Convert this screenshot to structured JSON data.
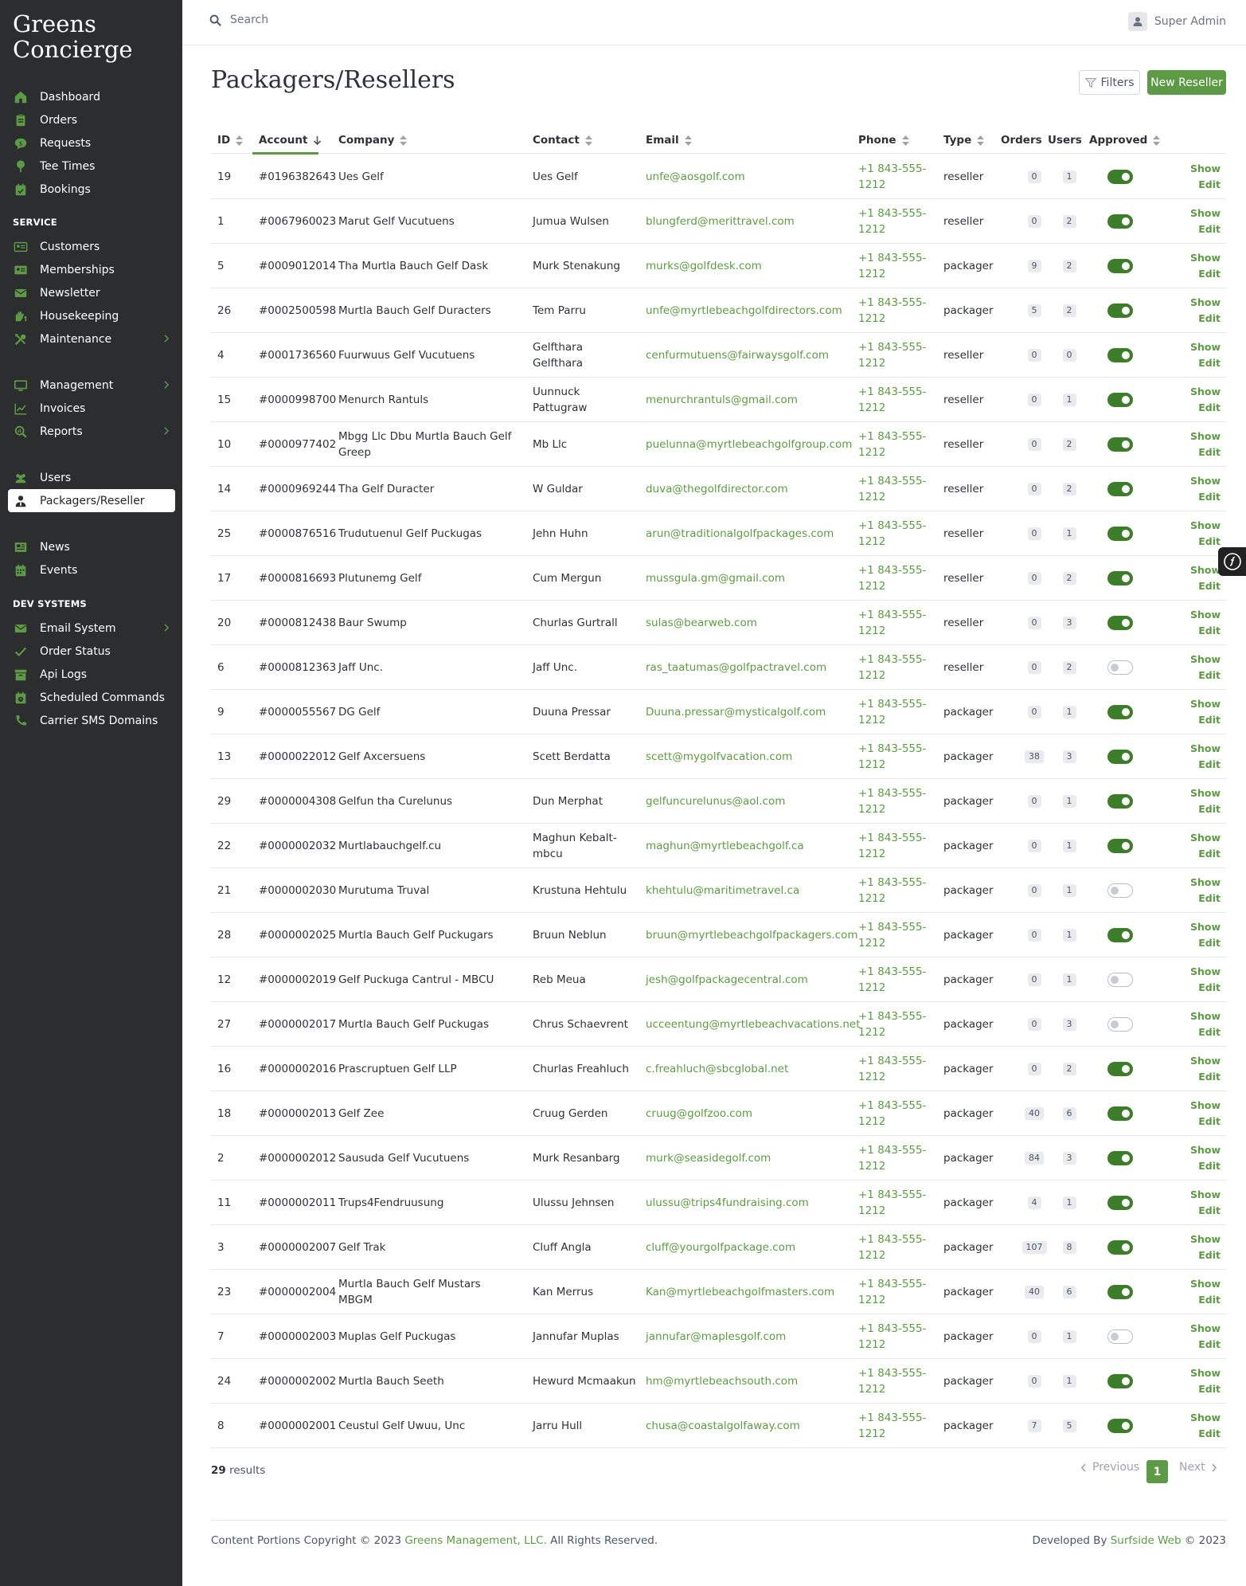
{
  "brand": {
    "line1": "Greens",
    "line2": "Concierge"
  },
  "sidebar": {
    "items_main": [
      {
        "label": "Dashboard",
        "icon": "home-icon"
      },
      {
        "label": "Orders",
        "icon": "clipboard-icon"
      },
      {
        "label": "Requests",
        "icon": "chat-icon"
      },
      {
        "label": "Tee Times",
        "icon": "golf-tee-icon"
      },
      {
        "label": "Bookings",
        "icon": "calendar-check-icon"
      }
    ],
    "section_service": "SERVICE",
    "items_service": [
      {
        "label": "Customers",
        "icon": "address-card-icon"
      },
      {
        "label": "Memberships",
        "icon": "id-card-icon"
      },
      {
        "label": "Newsletter",
        "icon": "envelope-icon"
      },
      {
        "label": "Housekeeping",
        "icon": "hands-icon"
      },
      {
        "label": "Maintenance",
        "icon": "tools-icon"
      }
    ],
    "items_manage": [
      {
        "label": "Management",
        "icon": "monitor-icon"
      },
      {
        "label": "Invoices",
        "icon": "chart-line-icon"
      },
      {
        "label": "Reports",
        "icon": "search-chart-icon"
      }
    ],
    "items_people": [
      {
        "label": "Users",
        "icon": "users-icon"
      },
      {
        "label": "Packagers/Reseller",
        "icon": "user-tie-icon"
      }
    ],
    "items_content": [
      {
        "label": "News",
        "icon": "newspaper-icon"
      },
      {
        "label": "Events",
        "icon": "calendar-icon"
      }
    ],
    "section_dev": "DEV SYSTEMS",
    "items_dev": [
      {
        "label": "Email System",
        "icon": "envelope-icon"
      },
      {
        "label": "Order Status",
        "icon": "check-icon"
      },
      {
        "label": "Api Logs",
        "icon": "archive-icon"
      },
      {
        "label": "Scheduled Commands",
        "icon": "calendar-clock-icon"
      },
      {
        "label": "Carrier SMS Domains",
        "icon": "phone-icon"
      }
    ]
  },
  "topbar": {
    "search_placeholder": "Search",
    "user_name": "Super Admin"
  },
  "page": {
    "title": "Packagers/Resellers",
    "filters_label": "Filters",
    "new_label": "New Reseller"
  },
  "table": {
    "headers": {
      "id": "ID",
      "account": "Account",
      "company": "Company",
      "contact": "Contact",
      "email": "Email",
      "phone": "Phone",
      "type": "Type",
      "orders": "Orders",
      "users": "Users",
      "approved": "Approved"
    },
    "show_label": "Show",
    "edit_label": "Edit",
    "rows": [
      {
        "id": "19",
        "account": "#0196382643",
        "company": "Ues Gelf",
        "contact": "Ues Gelf",
        "email": "unfe@aosgolf.com",
        "phone": "+1 843-555-1212",
        "type": "reseller",
        "orders": "0",
        "users": "1",
        "approved": true
      },
      {
        "id": "1",
        "account": "#0067960023",
        "company": "Marut Gelf Vucutuens",
        "contact": "Jumua Wulsen",
        "email": "blungferd@merittravel.com",
        "phone": "+1 843-555-1212",
        "type": "reseller",
        "orders": "0",
        "users": "2",
        "approved": true
      },
      {
        "id": "5",
        "account": "#0009012014",
        "company": "Tha Murtla Bauch Gelf Dask",
        "contact": "Murk Stenakung",
        "email": "murks@golfdesk.com",
        "phone": "+1 843-555-1212",
        "type": "packager",
        "orders": "9",
        "users": "2",
        "approved": true
      },
      {
        "id": "26",
        "account": "#0002500598",
        "company": "Murtla Bauch Gelf Duracters",
        "contact": "Tem Parru",
        "email": "unfe@myrtlebeachgolfdirectors.com",
        "phone": "+1 843-555-1212",
        "type": "packager",
        "orders": "5",
        "users": "2",
        "approved": true
      },
      {
        "id": "4",
        "account": "#0001736560",
        "company": "Fuurwuus Gelf Vucutuens",
        "contact": "Gelfthara Gelfthara",
        "email": "cenfurmutuens@fairwaysgolf.com",
        "phone": "+1 843-555-1212",
        "type": "reseller",
        "orders": "0",
        "users": "0",
        "approved": true
      },
      {
        "id": "15",
        "account": "#0000998700",
        "company": "Menurch Rantuls",
        "contact": "Uunnuck Pattugraw",
        "email": "menurchrantuls@gmail.com",
        "phone": "+1 843-555-1212",
        "type": "reseller",
        "orders": "0",
        "users": "1",
        "approved": true
      },
      {
        "id": "10",
        "account": "#0000977402",
        "company": "Mbgg Llc Dbu Murtla Bauch Gelf Greep",
        "contact": "Mb Llc",
        "email": "puelunna@myrtlebeachgolfgroup.com",
        "phone": "+1 843-555-1212",
        "type": "reseller",
        "orders": "0",
        "users": "2",
        "approved": true
      },
      {
        "id": "14",
        "account": "#0000969244",
        "company": "Tha Gelf Duracter",
        "contact": "W Guldar",
        "email": "duva@thegolfdirector.com",
        "phone": "+1 843-555-1212",
        "type": "reseller",
        "orders": "0",
        "users": "2",
        "approved": true
      },
      {
        "id": "25",
        "account": "#0000876516",
        "company": "Trudutuenul Gelf Puckugas",
        "contact": "Jehn Huhn",
        "email": "arun@traditionalgolfpackages.com",
        "phone": "+1 843-555-1212",
        "type": "reseller",
        "orders": "0",
        "users": "1",
        "approved": true
      },
      {
        "id": "17",
        "account": "#0000816693",
        "company": "Plutunemg Gelf",
        "contact": "Cum Mergun",
        "email": "mussgula.gm@gmail.com",
        "phone": "+1 843-555-1212",
        "type": "reseller",
        "orders": "0",
        "users": "2",
        "approved": true
      },
      {
        "id": "20",
        "account": "#0000812438",
        "company": "Baur Swump",
        "contact": "Churlas Gurtrall",
        "email": "sulas@bearweb.com",
        "phone": "+1 843-555-1212",
        "type": "reseller",
        "orders": "0",
        "users": "3",
        "approved": true
      },
      {
        "id": "6",
        "account": "#0000812363",
        "company": "Jaff Unc.",
        "contact": "Jaff Unc.",
        "email": "ras_taatumas@golfpactravel.com",
        "phone": "+1 843-555-1212",
        "type": "reseller",
        "orders": "0",
        "users": "2",
        "approved": false
      },
      {
        "id": "9",
        "account": "#0000055567",
        "company": "DG Gelf",
        "contact": "Duuna Pressar",
        "email": "Duuna.pressar@mysticalgolf.com",
        "phone": "+1 843-555-1212",
        "type": "packager",
        "orders": "0",
        "users": "1",
        "approved": true
      },
      {
        "id": "13",
        "account": "#0000022012",
        "company": "Gelf Axcersuens",
        "contact": "Scett Berdatta",
        "email": "scett@mygolfvacation.com",
        "phone": "+1 843-555-1212",
        "type": "packager",
        "orders": "38",
        "users": "3",
        "approved": true
      },
      {
        "id": "29",
        "account": "#0000004308",
        "company": "Gelfun tha Curelunus",
        "contact": "Dun Merphat",
        "email": "gelfuncurelunus@aol.com",
        "phone": "+1 843-555-1212",
        "type": "packager",
        "orders": "0",
        "users": "1",
        "approved": true
      },
      {
        "id": "22",
        "account": "#0000002032",
        "company": "Murtlabauchgelf.cu",
        "contact": "Maghun Kebalt-mbcu",
        "email": "maghun@myrtlebeachgolf.ca",
        "phone": "+1 843-555-1212",
        "type": "packager",
        "orders": "0",
        "users": "1",
        "approved": true
      },
      {
        "id": "21",
        "account": "#0000002030",
        "company": "Murutuma Truval",
        "contact": "Krustuna Hehtulu",
        "email": "khehtulu@maritimetravel.ca",
        "phone": "+1 843-555-1212",
        "type": "packager",
        "orders": "0",
        "users": "1",
        "approved": false
      },
      {
        "id": "28",
        "account": "#0000002025",
        "company": "Murtla Bauch Gelf Puckugars",
        "contact": "Bruun Neblun",
        "email": "bruun@myrtlebeachgolfpackagers.com",
        "phone": "+1 843-555-1212",
        "type": "packager",
        "orders": "0",
        "users": "1",
        "approved": true
      },
      {
        "id": "12",
        "account": "#0000002019",
        "company": "Gelf Puckuga Cantrul - MBCU",
        "contact": "Reb Meua",
        "email": "jesh@golfpackagecentral.com",
        "phone": "+1 843-555-1212",
        "type": "packager",
        "orders": "0",
        "users": "1",
        "approved": false
      },
      {
        "id": "27",
        "account": "#0000002017",
        "company": "Murtla Bauch Gelf Puckugas",
        "contact": "Chrus Schaevrent",
        "email": "ucceentung@myrtlebeachvacations.net",
        "phone": "+1 843-555-1212",
        "type": "packager",
        "orders": "0",
        "users": "3",
        "approved": false
      },
      {
        "id": "16",
        "account": "#0000002016",
        "company": "Prascruptuen Gelf LLP",
        "contact": "Churlas Freahluch",
        "email": "c.freahluch@sbcglobal.net",
        "phone": "+1 843-555-1212",
        "type": "packager",
        "orders": "0",
        "users": "2",
        "approved": true
      },
      {
        "id": "18",
        "account": "#0000002013",
        "company": "Gelf Zee",
        "contact": "Cruug Gerden",
        "email": "cruug@golfzoo.com",
        "phone": "+1 843-555-1212",
        "type": "packager",
        "orders": "40",
        "users": "6",
        "approved": true
      },
      {
        "id": "2",
        "account": "#0000002012",
        "company": "Sausuda Gelf Vucutuens",
        "contact": "Murk Resanbarg",
        "email": "murk@seasidegolf.com",
        "phone": "+1 843-555-1212",
        "type": "packager",
        "orders": "84",
        "users": "3",
        "approved": true
      },
      {
        "id": "11",
        "account": "#0000002011",
        "company": "Trups4Fendruusung",
        "contact": "Ulussu Jehnsen",
        "email": "ulussu@trips4fundraising.com",
        "phone": "+1 843-555-1212",
        "type": "packager",
        "orders": "4",
        "users": "1",
        "approved": true
      },
      {
        "id": "3",
        "account": "#0000002007",
        "company": "Gelf Trak",
        "contact": "Cluff Angla",
        "email": "cluff@yourgolfpackage.com",
        "phone": "+1 843-555-1212",
        "type": "packager",
        "orders": "107",
        "users": "8",
        "approved": true
      },
      {
        "id": "23",
        "account": "#0000002004",
        "company": "Murtla Bauch Gelf Mustars MBGM",
        "contact": "Kan Merrus",
        "email": "Kan@myrtlebeachgolfmasters.com",
        "phone": "+1 843-555-1212",
        "type": "packager",
        "orders": "40",
        "users": "6",
        "approved": true
      },
      {
        "id": "7",
        "account": "#0000002003",
        "company": "Muplas Gelf Puckugas",
        "contact": "Jannufar Muplas",
        "email": "jannufar@maplesgolf.com",
        "phone": "+1 843-555-1212",
        "type": "packager",
        "orders": "0",
        "users": "1",
        "approved": false
      },
      {
        "id": "24",
        "account": "#0000002002",
        "company": "Murtla Bauch Seeth",
        "contact": "Hewurd Mcmaakun",
        "email": "hm@myrtlebeachsouth.com",
        "phone": "+1 843-555-1212",
        "type": "packager",
        "orders": "0",
        "users": "1",
        "approved": true
      },
      {
        "id": "8",
        "account": "#0000002001",
        "company": "Ceustul Gelf Uwuu, Unc",
        "contact": "Jarru Hull",
        "email": "chusa@coastalgolfaway.com",
        "phone": "+1 843-555-1212",
        "type": "packager",
        "orders": "7",
        "users": "5",
        "approved": true
      }
    ]
  },
  "pagination": {
    "count": "29",
    "results_word": "results",
    "previous": "Previous",
    "current": "1",
    "next": "Next"
  },
  "footer": {
    "left_prefix": "Content Portions Copyright © 2023",
    "left_link": "Greens Management, LLC.",
    "left_suffix": "All Rights Reserved.",
    "right_prefix": "Developed By",
    "right_link": "Surfside Web",
    "right_suffix": "© 2023"
  },
  "colors": {
    "accent": "#5e9a45",
    "sidebar_bg": "#2b2d2f",
    "toggle_on": "#3d7d2a"
  }
}
